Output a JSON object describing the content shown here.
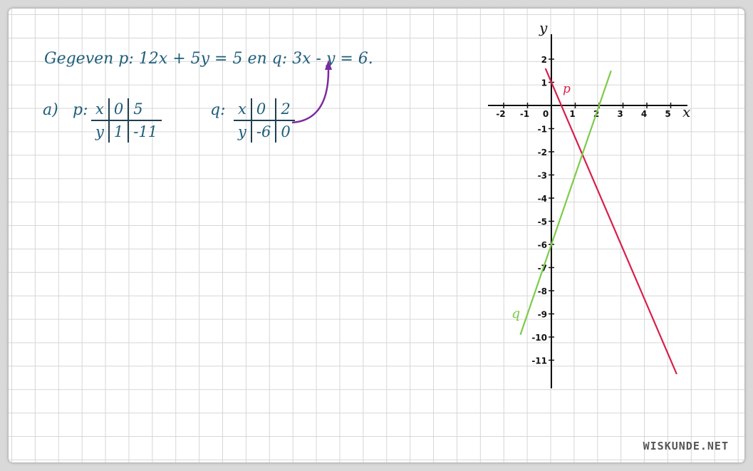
{
  "header": {
    "given_text": "Gegeven  p: 12x + 5y = 5  en  q: 3x - y = 6."
  },
  "part_a": {
    "label": "a)",
    "p": {
      "name": "p:",
      "x_header": "x",
      "y_header": "y",
      "x_values": [
        "0",
        "5"
      ],
      "y_values": [
        "1",
        "-11"
      ]
    },
    "q": {
      "name": "q:",
      "x_header": "x",
      "y_header": "y",
      "x_values": [
        "0",
        "2"
      ],
      "y_values": [
        "-6",
        "0"
      ]
    }
  },
  "graph": {
    "x_axis_label": "x",
    "y_axis_label": "y",
    "x_ticks": [
      "-2",
      "-1",
      "0",
      "1",
      "2",
      "3",
      "4",
      "5"
    ],
    "y_ticks": [
      "2",
      "1",
      "-1",
      "-2",
      "-3",
      "-4",
      "-5",
      "-6",
      "-7",
      "-8",
      "-9",
      "-10",
      "-11"
    ],
    "line_p_label": "p",
    "line_q_label": "q",
    "colors": {
      "p": "#d81e4a",
      "q": "#7ccb4a",
      "axes": "#111111",
      "arrow": "#7a2aa0",
      "handwriting": "#1f5e7a"
    }
  },
  "chart_data": {
    "type": "line",
    "xlabel": "x",
    "ylabel": "y",
    "xlim": [
      -2,
      5
    ],
    "ylim": [
      -11,
      2
    ],
    "series": [
      {
        "name": "p",
        "x": [
          -0.25,
          5.25
        ],
        "y": [
          1.6,
          -11.6
        ]
      },
      {
        "name": "q",
        "x": [
          -1.3,
          2.5
        ],
        "y": [
          -9.9,
          1.5
        ]
      }
    ]
  },
  "footer": {
    "logo": "WISKUNDE.NET"
  }
}
